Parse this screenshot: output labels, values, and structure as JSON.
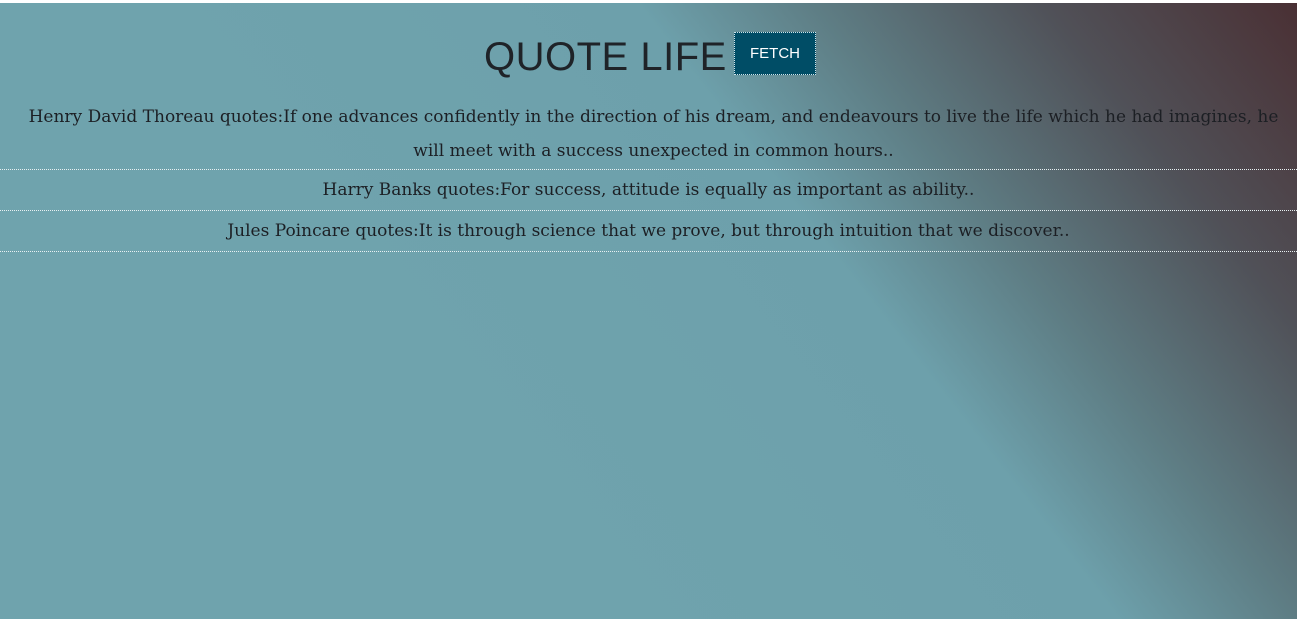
{
  "app": {
    "title": "QUOTE LIFE",
    "fetch_label": "FETCH"
  },
  "quotes": [
    {
      "text": "Henry David Thoreau quotes:If one advances confidently in the direction of his dream, and endeavours to live the life which he had imagines, he will meet with a success unexpected in common hours.."
    },
    {
      "text": "Harry Banks quotes:For success, attitude is equally as important as ability.."
    },
    {
      "text": "Jules Poincare quotes:It is through science that we prove, but through intuition that we discover.."
    }
  ],
  "colors": {
    "button_bg": "#004d66",
    "background_light": "#6fa1ad",
    "background_dark": "#4a3236"
  }
}
